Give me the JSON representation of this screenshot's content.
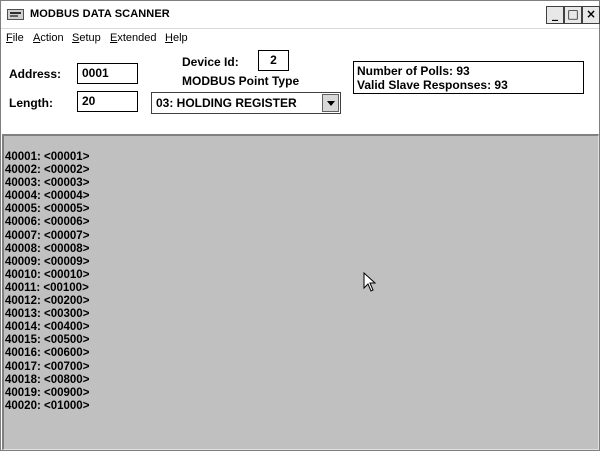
{
  "window": {
    "title": "MODBUS DATA SCANNER",
    "buttons": {
      "minimize": "_",
      "maximize": "□",
      "close": "×"
    }
  },
  "menu": [
    {
      "accel": "F",
      "rest": "ile"
    },
    {
      "accel": "A",
      "rest": "ction"
    },
    {
      "accel": "S",
      "rest": "etup"
    },
    {
      "accel": "E",
      "rest": "xtended"
    },
    {
      "accel": "H",
      "rest": "elp"
    }
  ],
  "form": {
    "address_label": "Address:",
    "address_value": "0001",
    "length_label": "Length:",
    "length_value": "20",
    "device_id_label": "Device Id:",
    "device_id_value": "2",
    "point_type_label": "MODBUS Point Type",
    "point_type_value": "03: HOLDING REGISTER"
  },
  "status": {
    "polls": "Number of Polls: 93",
    "responses": "Valid Slave Responses: 93"
  },
  "registers": [
    "40001: <00001>",
    "40002: <00002>",
    "40003: <00003>",
    "40004: <00004>",
    "40005: <00005>",
    "40006: <00006>",
    "40007: <00007>",
    "40008: <00008>",
    "40009: <00009>",
    "40010: <00010>",
    "40011: <00100>",
    "40012: <00200>",
    "40013: <00300>",
    "40014: <00400>",
    "40015: <00500>",
    "40016: <00600>",
    "40017: <00700>",
    "40018: <00800>",
    "40019: <00900>",
    "40020: <01000>"
  ]
}
